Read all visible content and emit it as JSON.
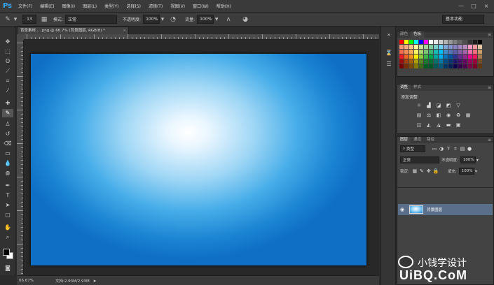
{
  "app": {
    "logo": "Ps",
    "menus": [
      "文件(F)",
      "编辑(E)",
      "图像(I)",
      "图层(L)",
      "类型(Y)",
      "选择(S)",
      "滤镜(T)",
      "视图(V)",
      "窗口(W)",
      "帮助(H)"
    ],
    "window_controls": [
      "—",
      "□",
      "×"
    ]
  },
  "options": {
    "brush_size": "13",
    "mode_label": "模式:",
    "mode_value": "正常",
    "opacity_label": "不透明度:",
    "opacity_value": "100%",
    "flow_label": "流量:",
    "flow_value": "100%",
    "workspace_preset": "基本功能"
  },
  "document": {
    "tab_title": "背景素材... .png @ 66.7% (背景图层, RGB/8) *",
    "close": "×",
    "zoom": "66.67%",
    "doc_info": "文档:2.93M/2.93M"
  },
  "panels": {
    "color_tabs": [
      "颜色",
      "色板"
    ],
    "adjust_tabs": [
      "调整",
      "样式"
    ],
    "adjust_title": "添加调整",
    "layer_tabs": [
      "图层",
      "通道",
      "路径"
    ],
    "layer_filter": "类型",
    "blend_mode": "正常",
    "opacity_label": "不透明度:",
    "opacity_value": "100%",
    "lock_label": "锁定:",
    "fill_label": "填充:",
    "fill_value": "100%",
    "layer_name": "背景图层"
  },
  "watermark": {
    "text": "小钱学设计",
    "logo": "UiBQ.CoM"
  },
  "colors": {
    "accent": "#33a9ff",
    "layer_selected": "#5a6f8a"
  }
}
